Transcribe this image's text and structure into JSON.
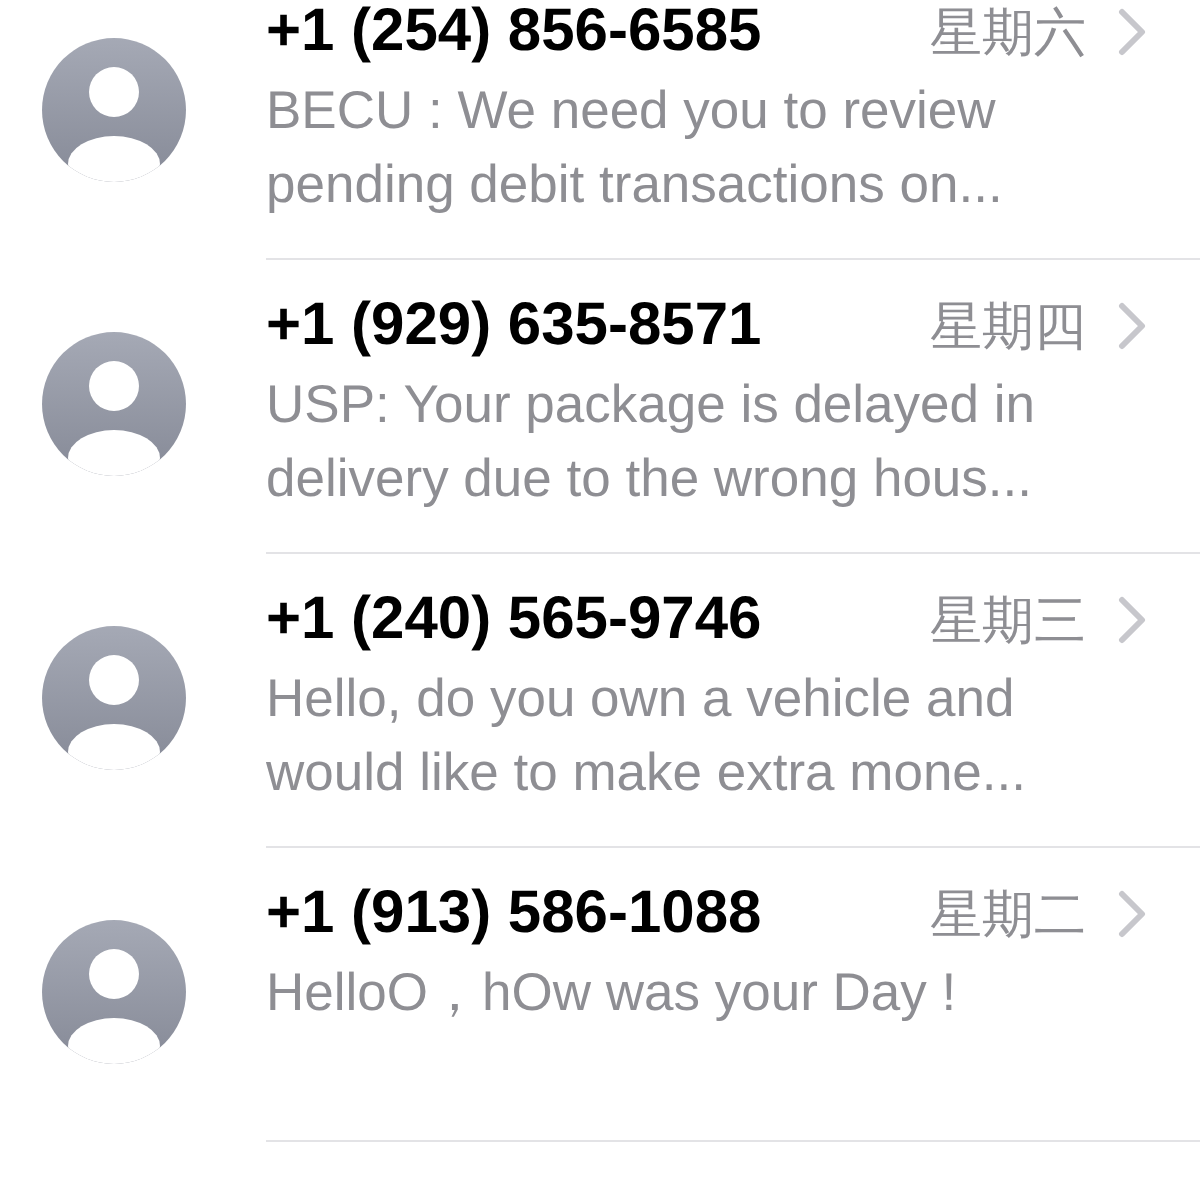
{
  "conversations": [
    {
      "sender": "+1 (254) 856-6585",
      "date": "星期六",
      "preview": "BECU : We need you to review pending debit transactions on..."
    },
    {
      "sender": "+1 (929) 635-8571",
      "date": "星期四",
      "preview": "USP: Your package is delayed in delivery due to the wrong hous..."
    },
    {
      "sender": "+1 (240) 565-9746",
      "date": "星期三",
      "preview": "Hello, do you own a vehicle and would like to make extra mone..."
    },
    {
      "sender": "+1 (913) 586-1088",
      "date": "星期二",
      "preview": "HelloO，hOw  was your Day !"
    }
  ]
}
